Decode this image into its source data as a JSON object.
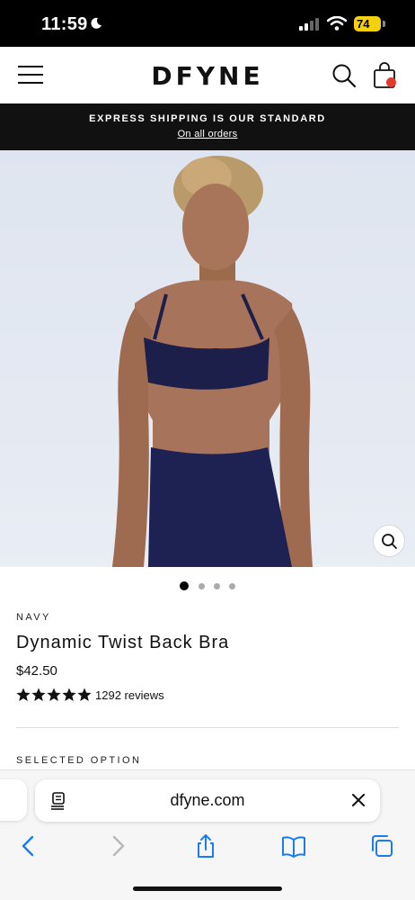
{
  "status_bar": {
    "time": "11:59",
    "battery": "74"
  },
  "header": {
    "logo": "DFYNE"
  },
  "announcement": {
    "title": "EXPRESS SHIPPING IS OUR STANDARD",
    "link": "On all orders"
  },
  "gallery": {
    "current_index": 1,
    "total": 4
  },
  "product": {
    "color": "NAVY",
    "title": "Dynamic Twist Back Bra",
    "price": "$42.50",
    "rating": 5,
    "reviews": "1292 reviews",
    "selected_option_label": "SELECTED OPTION"
  },
  "browser": {
    "url": "dfyne.com"
  },
  "icons": {
    "menu": "menu-icon",
    "search": "search-icon",
    "bag": "bag-icon",
    "zoom": "zoom-icon",
    "reader": "reader-icon",
    "close": "close-icon",
    "back": "back-icon",
    "forward": "forward-icon",
    "share": "share-icon",
    "bookmarks": "bookmarks-icon",
    "tabs": "tabs-icon"
  },
  "colors": {
    "accent_dot": "#e23b2b",
    "battery": "#f5d10a",
    "ios_blue": "#1a7cf5",
    "navy": "#1b1f4a"
  }
}
